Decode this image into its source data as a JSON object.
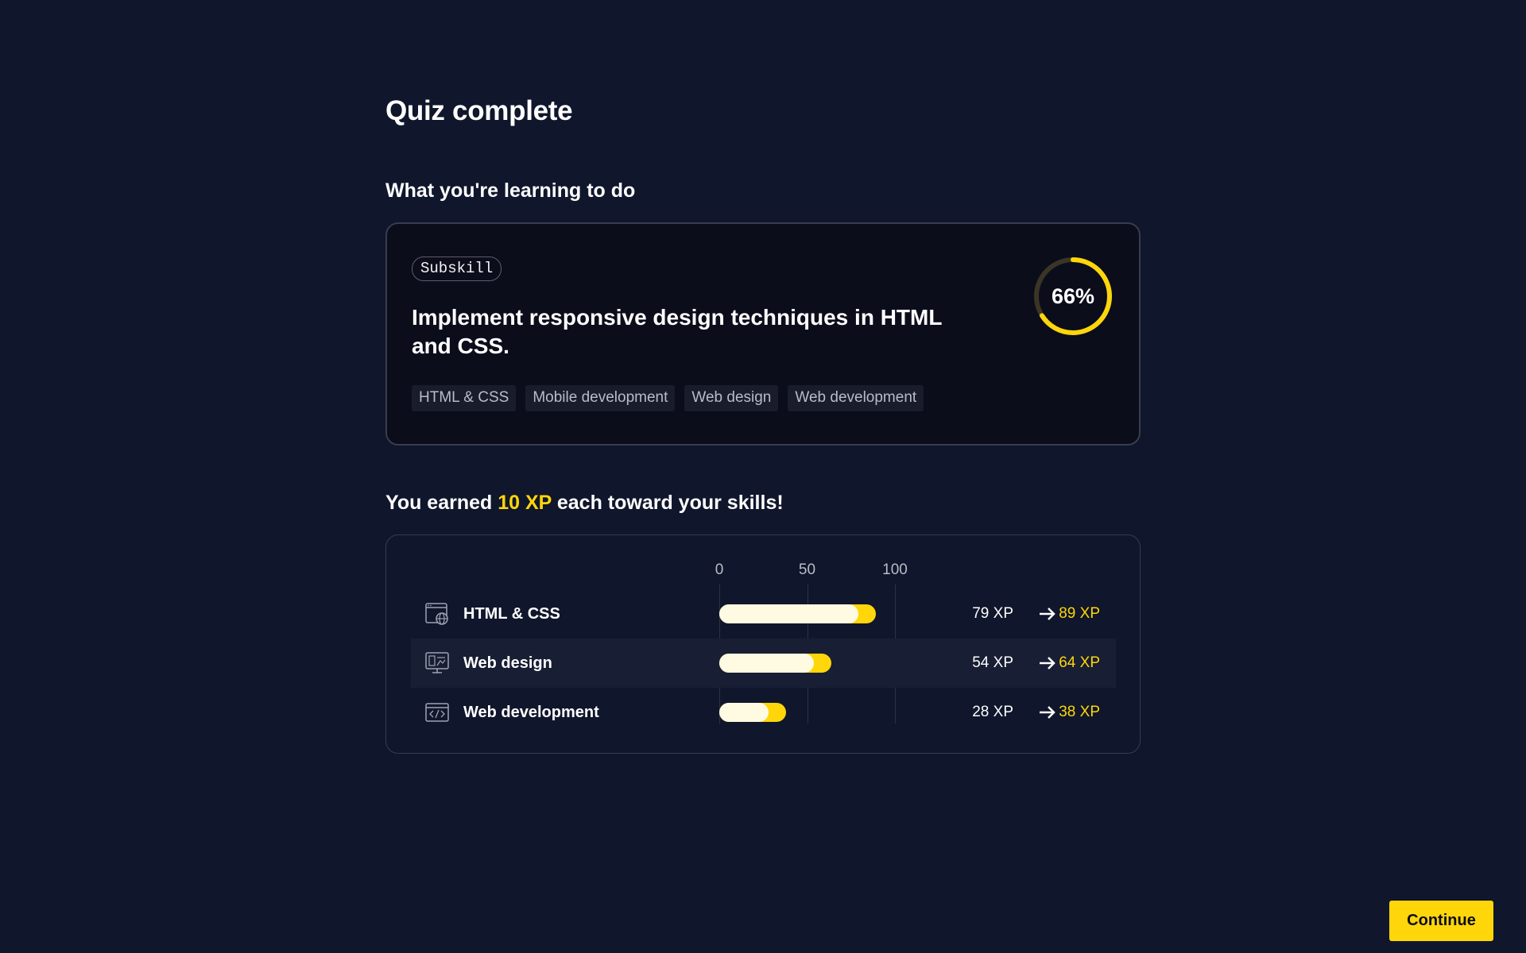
{
  "page": {
    "title": "Quiz complete"
  },
  "learning": {
    "section_title": "What you're learning to do",
    "badge": "Subskill",
    "heading": "Implement responsive design techniques in HTML and CSS.",
    "progress_label": "66%",
    "progress_value": 0.66,
    "tags": [
      "HTML & CSS",
      "Mobile development",
      "Web design",
      "Web development"
    ]
  },
  "xp": {
    "title_prefix": "You earned ",
    "title_highlight": "10 XP",
    "title_suffix": " each toward your skills!",
    "scale": [
      "0",
      "50",
      "100"
    ],
    "skills": [
      {
        "name": "HTML & CSS",
        "icon": "globe-window-icon",
        "old_xp": 79,
        "new_xp": 89,
        "old_label": "79 XP",
        "new_label": "89 XP"
      },
      {
        "name": "Web design",
        "icon": "monitor-design-icon",
        "old_xp": 54,
        "new_xp": 64,
        "old_label": "54 XP",
        "new_label": "64 XP"
      },
      {
        "name": "Web development",
        "icon": "code-window-icon",
        "old_xp": 28,
        "new_xp": 38,
        "old_label": "28 XP",
        "new_label": "38 XP"
      }
    ]
  },
  "footer": {
    "continue_label": "Continue"
  },
  "colors": {
    "background": "#10162b",
    "accent": "#ffd60a",
    "card": "#0b0d1b",
    "bar_old": "#fffbe3"
  }
}
